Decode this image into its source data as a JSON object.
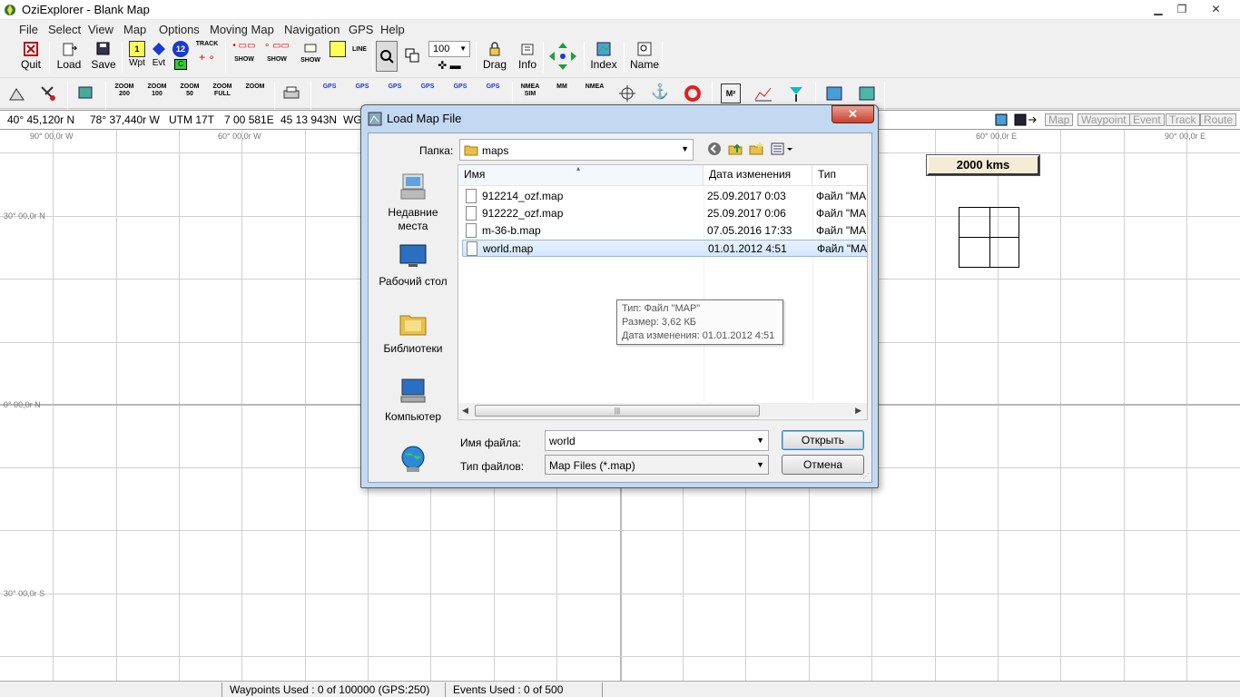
{
  "window": {
    "title": "OziExplorer - Blank Map",
    "min_glyph": "▁",
    "max_glyph": "❐",
    "close_glyph": "✕"
  },
  "menu": [
    "File",
    "Select",
    "View",
    "Map",
    "Options",
    "Moving Map",
    "Navigation",
    "GPS",
    "Help"
  ],
  "toolbar1": {
    "quit": "Quit",
    "load": "Load",
    "save": "Save",
    "wpt": "Wpt",
    "evt": "Evt",
    "track_tag": "TRACK",
    "show1": "SHOW",
    "show2": "SHOW",
    "show3": "SHOW",
    "line_tag": "LINE",
    "zoom_value": "100",
    "drag": "Drag",
    "info": "Info",
    "index": "Index",
    "name": "Name",
    "num12": "12",
    "num1": "1",
    "c": "C"
  },
  "toolbar2": {
    "zoom200": "ZOOM 200",
    "zoom100": "ZOOM 100",
    "zoom50": "ZOOM 50",
    "zoomfull": "ZOOM FULL",
    "zoom": "ZOOM",
    "gps1": "GPS",
    "gps2": "GPS",
    "gps3": "GPS",
    "gps4": "GPS",
    "gps5": "GPS",
    "gps6": "GPS",
    "nmea_sim": "NMEA SIM",
    "mm": "MM",
    "nmea": "NMEA",
    "m2": "M²"
  },
  "coords": {
    "lat": "40° 45,120r N",
    "lon": "78° 37,440r W",
    "utm": "UTM  17T",
    "easting": "7 00 581E",
    "northing": "45 13 943N",
    "datum": "WG"
  },
  "layers": [
    "Map",
    "Waypoint",
    "Event",
    "Track",
    "Route"
  ],
  "grid_labels": {
    "top": [
      "90° 00,0r W",
      "60° 00,0r W",
      "60° 00,0r E",
      "90° 00,0r E"
    ],
    "left": [
      "30° 00,0r N",
      "0° 00,0r N",
      "30° 00,0r S"
    ]
  },
  "scale": "2000 kms",
  "status": {
    "waypoints": "Waypoints Used : 0 of 100000  (GPS:250)",
    "events": "Events Used : 0 of 500"
  },
  "dialog": {
    "title": "Load Map File",
    "close": "✕",
    "lookin_label": "Папка:",
    "lookin_value": "maps",
    "places": [
      "Недавние места",
      "Рабочий стол",
      "Библиотеки",
      "Компьютер"
    ],
    "columns": {
      "name": "Имя",
      "date": "Дата изменения",
      "type": "Тип"
    },
    "files": [
      {
        "name": "912214_ozf.map",
        "date": "25.09.2017 0:03",
        "type": "Файл \"MAP\""
      },
      {
        "name": "912222_ozf.map",
        "date": "25.09.2017 0:06",
        "type": "Файл \"MAP\""
      },
      {
        "name": "m-36-b.map",
        "date": "07.05.2016 17:33",
        "type": "Файл \"MAP\""
      },
      {
        "name": "world.map",
        "date": "01.01.2012 4:51",
        "type": "Файл \"MAP\""
      }
    ],
    "tooltip": {
      "type": "Тип: Файл \"MAP\"",
      "size": "Размер: 3,62 КБ",
      "modified": "Дата изменения: 01.01.2012 4:51"
    },
    "filename_label": "Имя файла:",
    "filename_value": "world",
    "filetype_label": "Тип файлов:",
    "filetype_value": "Map Files (*.map)",
    "open": "Открыть",
    "cancel": "Отмена"
  }
}
